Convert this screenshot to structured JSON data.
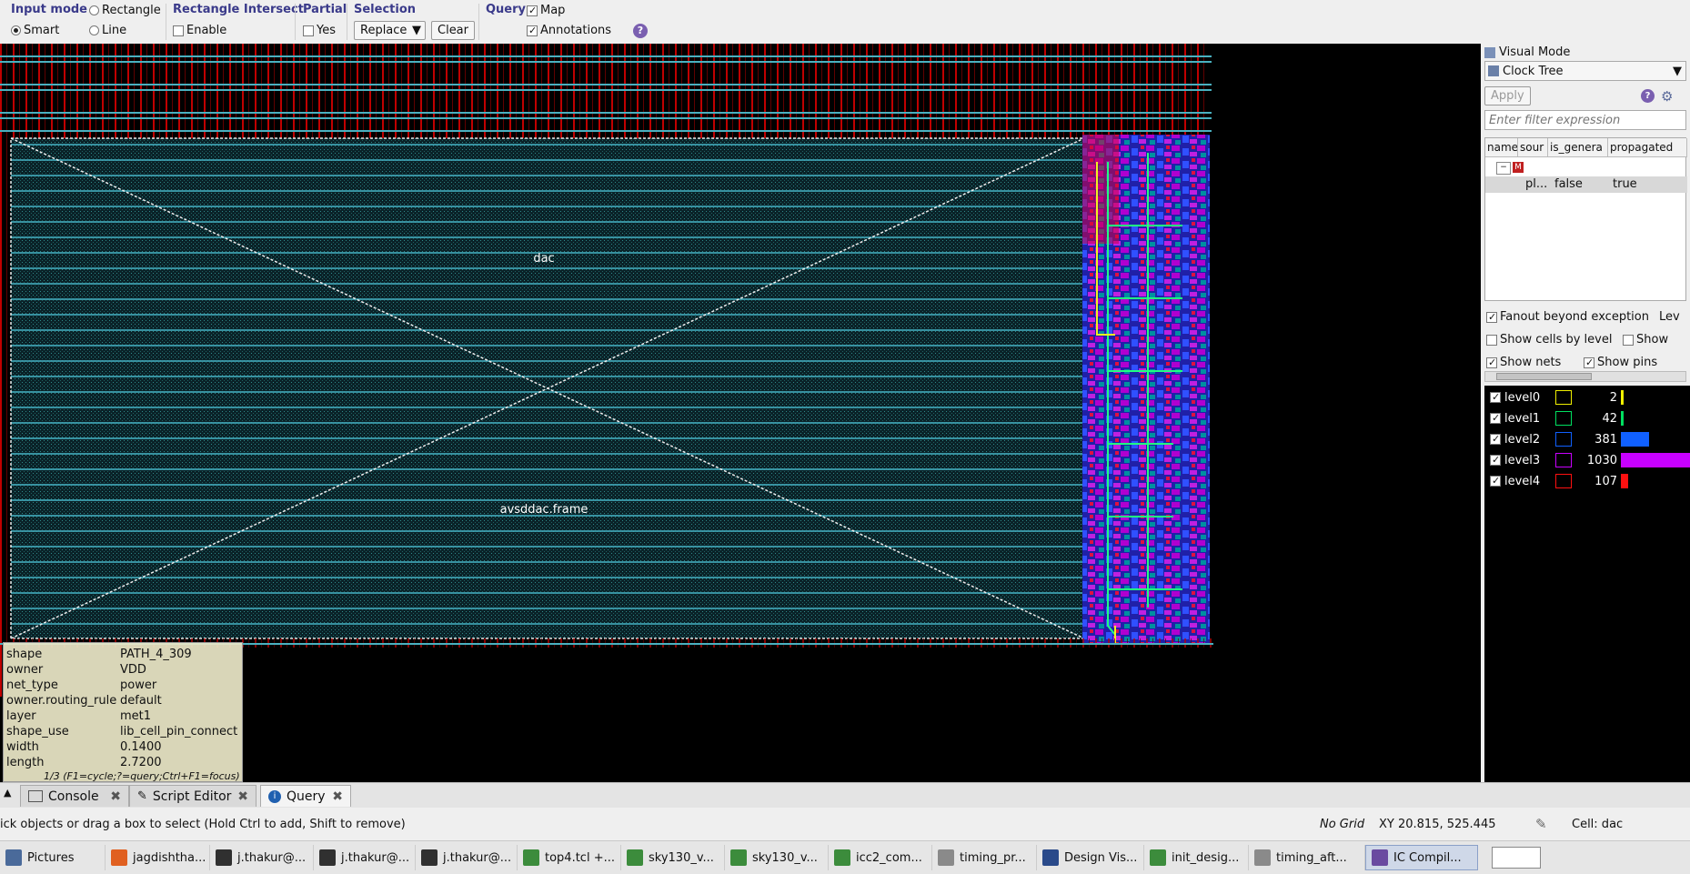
{
  "toolbar": {
    "input_mode": {
      "title": "Input mode",
      "smart": "Smart",
      "rectangle": "Rectangle",
      "line": "Line"
    },
    "rect_intersect": {
      "title": "Rectangle Intersect",
      "enable": "Enable"
    },
    "partial": {
      "title": "Partial",
      "yes": "Yes"
    },
    "selection": {
      "title": "Selection",
      "mode": "Replace",
      "clear": "Clear"
    },
    "query": {
      "title": "Query",
      "map": "Map",
      "annotations": "Annotations"
    }
  },
  "canvas": {
    "block_label": "dac",
    "frame_label": "avsddac.frame"
  },
  "tooltip": {
    "rows": [
      {
        "key": "shape",
        "value": "PATH_4_309"
      },
      {
        "key": "owner",
        "value": "VDD"
      },
      {
        "key": "net_type",
        "value": "power"
      },
      {
        "key": "owner.routing_rule",
        "value": "default"
      },
      {
        "key": "layer",
        "value": "met1"
      },
      {
        "key": "shape_use",
        "value": "lib_cell_pin_connect"
      },
      {
        "key": "width",
        "value": "0.1400"
      },
      {
        "key": "length",
        "value": "2.7200"
      }
    ],
    "footer": "1/3 (F1=cycle;?=query;Ctrl+F1=focus)"
  },
  "panel": {
    "title": "Visual Mode",
    "mode": "Clock Tree",
    "apply": "Apply",
    "filter_placeholder": "Enter filter expression",
    "columns": [
      "name",
      "sour",
      "is_genera",
      "propagated"
    ],
    "row": {
      "name": "pl...",
      "is_generated": "false",
      "propagated": "true"
    },
    "fanout": "Fanout beyond exception",
    "fanout_extra": "Lev",
    "show_cells": "Show cells by level",
    "show_extra": "Show",
    "show_nets": "Show nets",
    "show_pins": "Show pins",
    "levels": [
      {
        "name": "level0",
        "count": "2",
        "color": "#f0f000",
        "frac": 0.0
      },
      {
        "name": "level1",
        "count": "42",
        "color": "#00e060",
        "frac": 0.04
      },
      {
        "name": "level2",
        "count": "381",
        "color": "#1060ff",
        "frac": 0.37
      },
      {
        "name": "level3",
        "count": "1030",
        "color": "#c800ff",
        "frac": 1.0
      },
      {
        "name": "level4",
        "count": "107",
        "color": "#ff1010",
        "frac": 0.1
      }
    ]
  },
  "tabs": [
    {
      "label": "Console"
    },
    {
      "label": "Script Editor"
    },
    {
      "label": "Query"
    }
  ],
  "status": {
    "hint": "ick objects or drag a box to select (Hold Ctrl to add, Shift to remove)",
    "grid": "No Grid",
    "xy": "XY 20.815, 525.445",
    "cell": "Cell: dac"
  },
  "taskbar": [
    {
      "label": "Pictures"
    },
    {
      "label": "jagdishtha..."
    },
    {
      "label": "j.thakur@..."
    },
    {
      "label": "j.thakur@..."
    },
    {
      "label": "j.thakur@..."
    },
    {
      "label": "top4.tcl +..."
    },
    {
      "label": "sky130_v..."
    },
    {
      "label": "sky130_v..."
    },
    {
      "label": "icc2_com..."
    },
    {
      "label": "timing_pr..."
    },
    {
      "label": "Design Vis..."
    },
    {
      "label": "init_desig..."
    },
    {
      "label": "timing_aft..."
    },
    {
      "label": "IC Compil..."
    }
  ]
}
